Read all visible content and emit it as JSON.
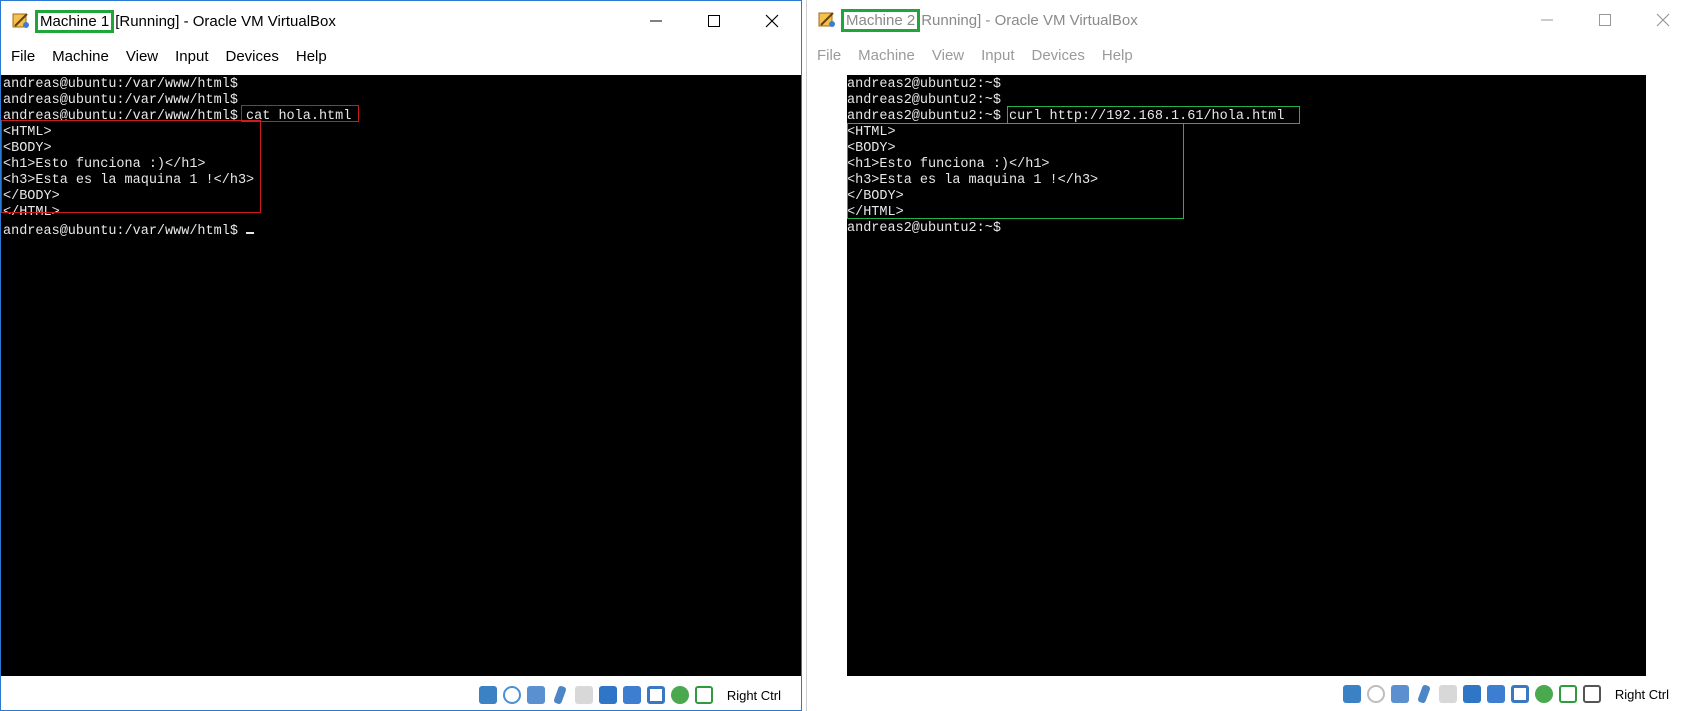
{
  "win1": {
    "title_highlight": "Machine 1",
    "title_rest": "[Running] - Oracle VM VirtualBox",
    "menu": [
      "File",
      "Machine",
      "View",
      "Input",
      "Devices",
      "Help"
    ],
    "terminal_lines": [
      "andreas@ubuntu:/var/www/html$",
      "andreas@ubuntu:/var/www/html$",
      "andreas@ubuntu:/var/www/html$ cat hola.html",
      "<HTML>",
      "<BODY>",
      "<h1>Esto funciona :)</h1>",
      "<h3>Esta es la maquina 1 !</h3>",
      "</BODY>",
      "</HTML>",
      "andreas@ubuntu:/var/www/html$ "
    ],
    "host_key": "Right Ctrl",
    "highlight_color": "#d11b1b"
  },
  "win2": {
    "title_highlight": "Machine 2",
    "title_rest": "Running] - Oracle VM VirtualBox",
    "menu": [
      "File",
      "Machine",
      "View",
      "Input",
      "Devices",
      "Help"
    ],
    "terminal_lines": [
      "andreas2@ubuntu2:~$",
      "andreas2@ubuntu2:~$",
      "andreas2@ubuntu2:~$ curl http://192.168.1.61/hola.html",
      "<HTML>",
      "<BODY>",
      "<h1>Esto funciona :)</h1>",
      "<h3>Esta es la maquina 1 !</h3>",
      "</BODY>",
      "</HTML>",
      "andreas2@ubuntu2:~$"
    ],
    "host_key": "Right Ctrl",
    "highlight_color": "#22b14c"
  },
  "icons": {
    "app": "virtualbox-icon",
    "status": [
      "hard-disk-icon",
      "optical-drive-icon",
      "audio-icon",
      "network-icon",
      "usb-icon",
      "shared-folders-icon",
      "display-icon",
      "video-capture-icon",
      "cpu-icon",
      "mouse-integration-icon",
      "keyboard-icon"
    ]
  }
}
